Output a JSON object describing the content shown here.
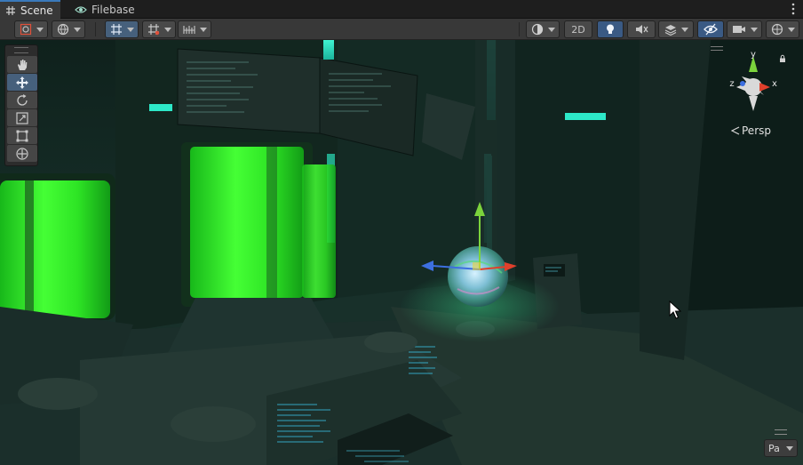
{
  "tabs": [
    {
      "label": "Scene",
      "icon": "scene-grid-icon",
      "active": true
    },
    {
      "label": "Filebase",
      "icon": "eye-icon",
      "active": false
    }
  ],
  "toolbar": {
    "draw_mode_icon": "draw-mode-icon",
    "global_icon": "global-icon",
    "gizmo_icon": "gizmo-toggle-icon",
    "grid_snap_icon": "grid-snap-icon",
    "increment_snap_icon": "increment-snap-icon",
    "shading_icon": "shading-sphere-icon",
    "mode_2d_label": "2D",
    "lighting_icon": "lightbulb-icon",
    "audio_icon": "audio-mute-icon",
    "effects_icon": "effects-layers-icon",
    "visibility_icon": "scene-visibility-icon",
    "camera_icon": "camera-icon",
    "gizmos_icon": "gizmos-globe-icon"
  },
  "tools": [
    {
      "name": "hand-tool",
      "icon": "hand-icon",
      "selected": false
    },
    {
      "name": "move-tool",
      "icon": "move-arrows-icon",
      "selected": true
    },
    {
      "name": "rotate-tool",
      "icon": "rotate-icon",
      "selected": false
    },
    {
      "name": "scale-tool",
      "icon": "scale-icon",
      "selected": false
    },
    {
      "name": "rect-tool",
      "icon": "rect-transform-icon",
      "selected": false
    },
    {
      "name": "transform-tool",
      "icon": "transform-icon",
      "selected": false
    }
  ],
  "gizmo": {
    "axis_y": "y",
    "axis_x": "x",
    "axis_z": "z",
    "projection_label": "Persp"
  },
  "overlay": {
    "pa_label": "Pa"
  },
  "colors": {
    "accent": "#3a79bb",
    "selected_tool": "#46607c",
    "axis_x": "#e0402c",
    "axis_y": "#7bd33c",
    "axis_z": "#3d6fe0",
    "glow_green": "#35ff2a",
    "glow_cyan": "#34e8c8"
  }
}
